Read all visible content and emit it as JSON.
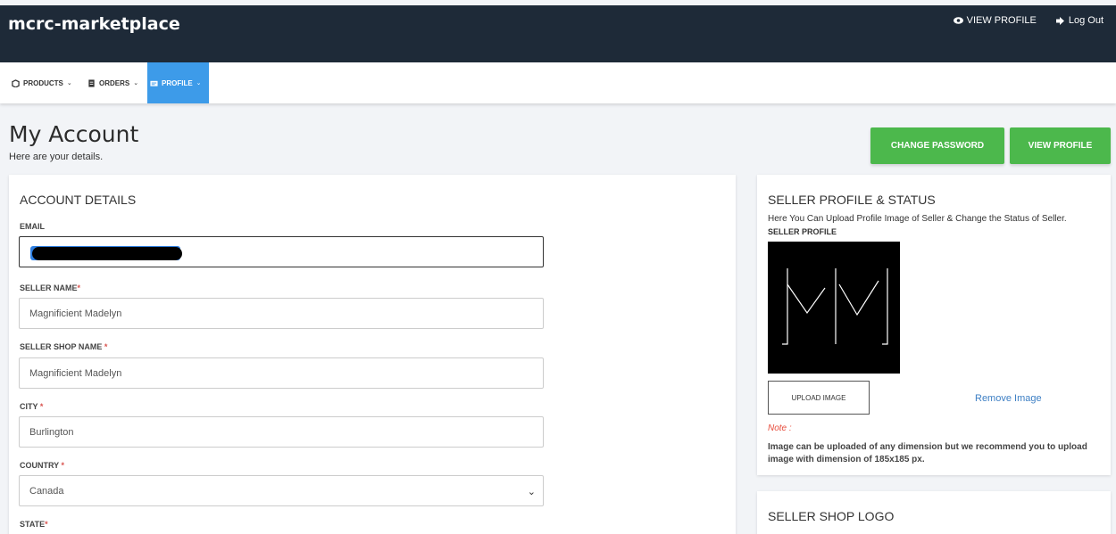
{
  "header": {
    "brand": "mcrc-marketplace",
    "view_profile": "VIEW PROFILE",
    "logout": "Log Out"
  },
  "nav": {
    "items": [
      {
        "label": "PRODUCTS",
        "icon": "box-icon"
      },
      {
        "label": "ORDERS",
        "icon": "receipt-icon"
      },
      {
        "label": "PROFILE",
        "icon": "id-card-icon",
        "active": true
      }
    ]
  },
  "page": {
    "title": "My Account",
    "subtitle": "Here are your details.",
    "change_password": "CHANGE PASSWORD",
    "view_profile": "VIEW PROFILE"
  },
  "account": {
    "title": "ACCOUNT DETAILS",
    "email_label": "EMAIL",
    "email_value": "",
    "seller_name_label": "SELLER NAME",
    "seller_name_value": "Magnificient Madelyn",
    "shop_name_label": "SELLER SHOP NAME ",
    "shop_name_value": "Magnificient Madelyn",
    "city_label": "CITY ",
    "city_value": "Burlington",
    "country_label": "COUNTRY ",
    "country_value": "Canada",
    "state_label": "STATE",
    "required_mark": "*"
  },
  "seller_profile": {
    "title": "SELLER PROFILE & STATUS",
    "description": "Here You Can Upload Profile Image of Seller & Change the Status of Seller.",
    "sub_label": "SELLER PROFILE",
    "upload": "UPLOAD IMAGE",
    "remove": "Remove Image",
    "note_label": "Note :",
    "note_text": "Image can be uploaded of any dimension but we recommend you to upload image with dimension of 185x185 px."
  },
  "shop_logo": {
    "title": "SELLER SHOP LOGO"
  },
  "colors": {
    "header_bg": "#1e2a38",
    "active_nav": "#3d9be9",
    "button_green": "#4cb84c",
    "link_blue": "#3d7fc4",
    "required_red": "#d9534f"
  }
}
